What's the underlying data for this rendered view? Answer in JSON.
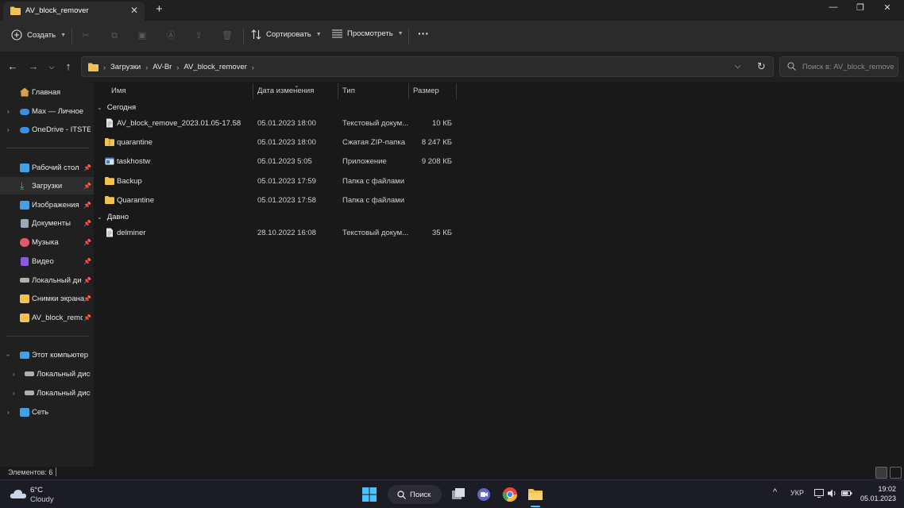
{
  "window": {
    "tab_title": "AV_block_remover",
    "minimize": "—",
    "maximize": "❐",
    "close": "✕"
  },
  "toolbar": {
    "create_label": "Создать",
    "sort_label": "Сортировать",
    "view_label": "Просмотреть",
    "more_label": "···"
  },
  "address": {
    "crumbs": [
      "Загрузки",
      "AV-Br",
      "AV_block_remover"
    ],
    "search_placeholder": "Поиск в: AV_block_remover"
  },
  "sidebar": {
    "items": [
      {
        "label": "Главная",
        "icon": "home-icon",
        "color": "#d9a24a"
      },
      {
        "label": "Max — Личное",
        "icon": "cloud-icon",
        "color": "#3b8fe0"
      },
      {
        "label": "OneDrive - ITSTEP",
        "icon": "cloud-icon",
        "color": "#3b8fe0"
      },
      {
        "label": "Рабочий стол",
        "icon": "desktop-icon",
        "color": "#3fa2e8"
      },
      {
        "label": "Загрузки",
        "icon": "download-icon",
        "color": "#3fbf7f"
      },
      {
        "label": "Изображения",
        "icon": "pictures-icon",
        "color": "#3fa2e8"
      },
      {
        "label": "Документы",
        "icon": "documents-icon",
        "color": "#9aa8b8"
      },
      {
        "label": "Музыка",
        "icon": "music-icon",
        "color": "#e05a6a"
      },
      {
        "label": "Видео",
        "icon": "video-icon",
        "color": "#8a5ae0"
      },
      {
        "label": "Локальный диск (C:)",
        "icon": "drive-icon",
        "color": "#b0b0b0"
      },
      {
        "label": "Снимки экрана",
        "icon": "folder-icon",
        "color": "#f2c14e"
      },
      {
        "label": "AV_block_remover",
        "icon": "folder-icon",
        "color": "#f2c14e"
      },
      {
        "label": "Этот компьютер",
        "icon": "computer-icon",
        "color": "#3fa2e8"
      },
      {
        "label": "Локальный диск (C:)",
        "icon": "drive-icon",
        "color": "#b0b0b0"
      },
      {
        "label": "Локальный диск (D:)",
        "icon": "drive-icon",
        "color": "#b0b0b0"
      },
      {
        "label": "Сеть",
        "icon": "network-icon",
        "color": "#3fa2e8"
      }
    ]
  },
  "columns": {
    "name": "Имя",
    "date": "Дата изменения",
    "type": "Тип",
    "size": "Размер"
  },
  "groups": {
    "today": "Сегодня",
    "earlier": "Давно"
  },
  "files": [
    {
      "name": "AV_block_remove_2023.01.05-17.58",
      "date": "05.01.2023 18:00",
      "type": "Текстовый докум...",
      "size": "10 КБ",
      "icon": "text-file-icon"
    },
    {
      "name": "quarantine",
      "date": "05.01.2023 18:00",
      "type": "Сжатая ZIP-папка",
      "size": "8 247 КБ",
      "icon": "zip-folder-icon"
    },
    {
      "name": "taskhostw",
      "date": "05.01.2023 5:05",
      "type": "Приложение",
      "size": "9 208 КБ",
      "icon": "app-icon"
    },
    {
      "name": "Backup",
      "date": "05.01.2023 17:59",
      "type": "Папка с файлами",
      "size": "",
      "icon": "folder-icon"
    },
    {
      "name": "Quarantine",
      "date": "05.01.2023 17:58",
      "type": "Папка с файлами",
      "size": "",
      "icon": "folder-icon"
    },
    {
      "name": "delminer",
      "date": "28.10.2022 16:08",
      "type": "Текстовый докум...",
      "size": "35 КБ",
      "icon": "text-file-icon"
    }
  ],
  "status": {
    "items_count": "Элементов: 6"
  },
  "taskbar": {
    "weather_temp": "6°C",
    "weather_desc": "Cloudy",
    "search_label": "Поиск",
    "language": "УКР",
    "time": "19:02",
    "date": "05.01.2023"
  }
}
